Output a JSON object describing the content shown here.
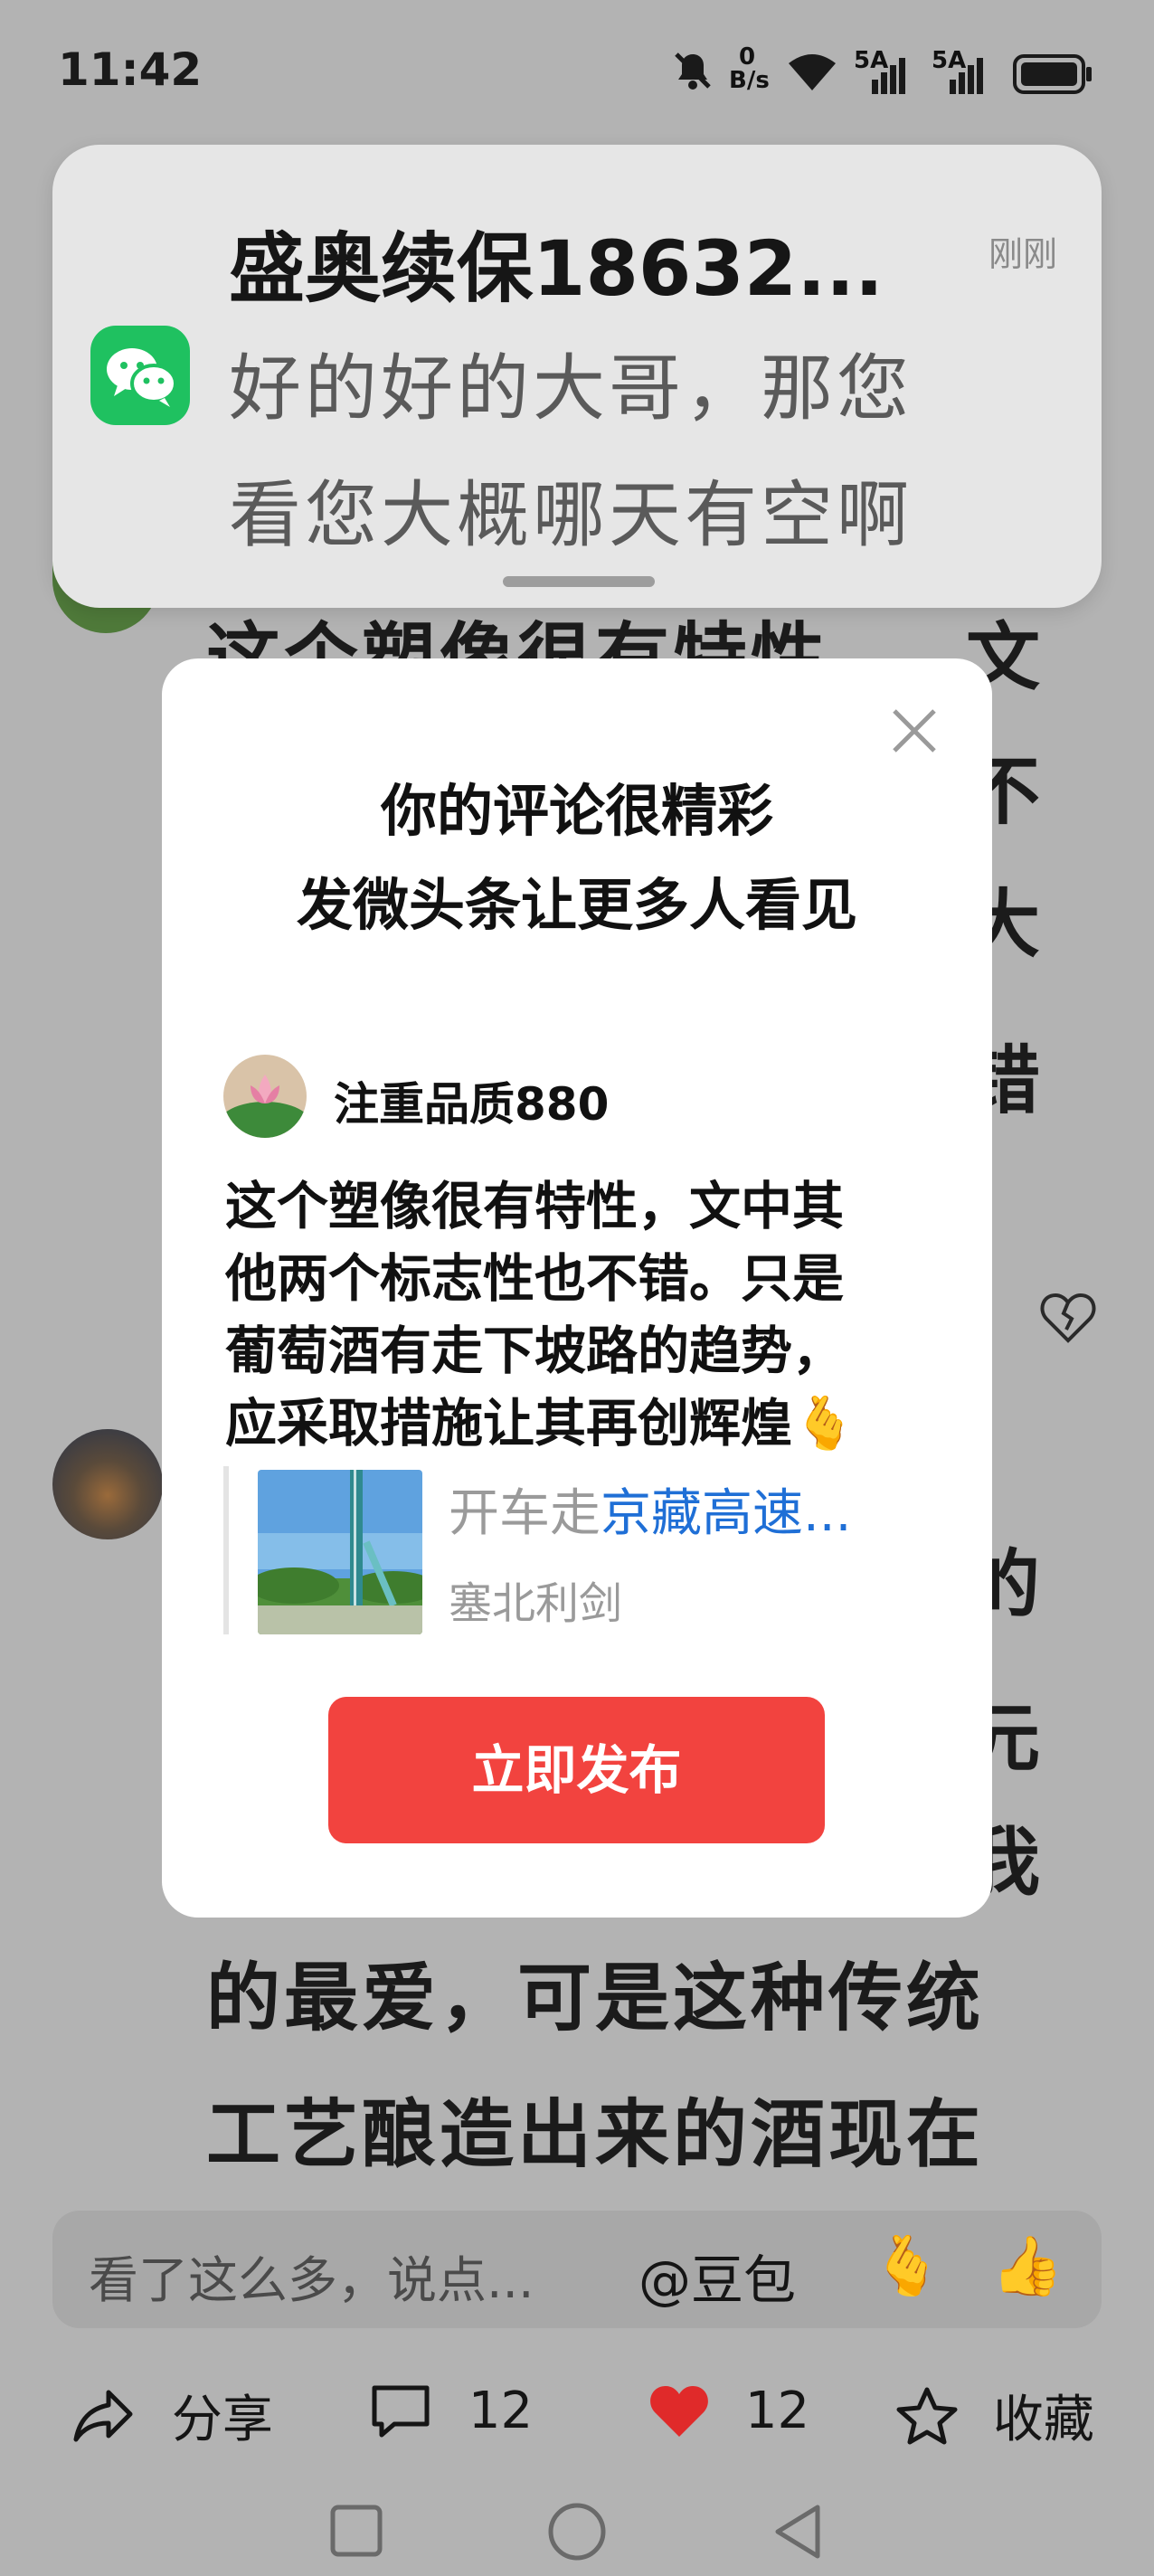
{
  "status_bar": {
    "time": "11:42",
    "net_speed_value": "0",
    "net_speed_unit": "B/s",
    "signal1_label": "5A",
    "signal2_label": "5A"
  },
  "notification": {
    "app_icon": "wechat-icon",
    "title": "盛奥续保18632...",
    "time": "刚刚",
    "message_line1": "好的好的大哥，那您",
    "message_line2": "看您大概哪天有空啊"
  },
  "background_article": {
    "lines_right": [
      "文",
      "不",
      "大",
      "错",
      "的",
      "元",
      "我"
    ],
    "partial_line": "这个塑像很有特性",
    "line_bottom1": "的最爱，可是这种传统",
    "line_bottom2": "工艺酿造出来的酒现在"
  },
  "popup": {
    "title_line1": "你的评论很精彩",
    "title_line2": "发微头条让更多人看见",
    "username": "注重品质880",
    "comment_lines": [
      "这个塑像很有特性，文中其",
      "他两个标志性也不错。只是",
      "葡萄酒有走下坡路的趋势，",
      "应采取措施让其再创辉煌🫰"
    ],
    "article_title_prefix": "开车走",
    "article_title_highlight": "京藏高速...",
    "article_author": "塞北利剑",
    "publish_button": "立即发布",
    "colors": {
      "accent": "#f2433f",
      "link": "#1f6fd6"
    }
  },
  "comment_input": {
    "placeholder": "看了这么多，说点...",
    "mention": "@豆包"
  },
  "actions": {
    "share_label": "分享",
    "comment_count": "12",
    "like_count": "12",
    "favorite_label": "收藏"
  }
}
